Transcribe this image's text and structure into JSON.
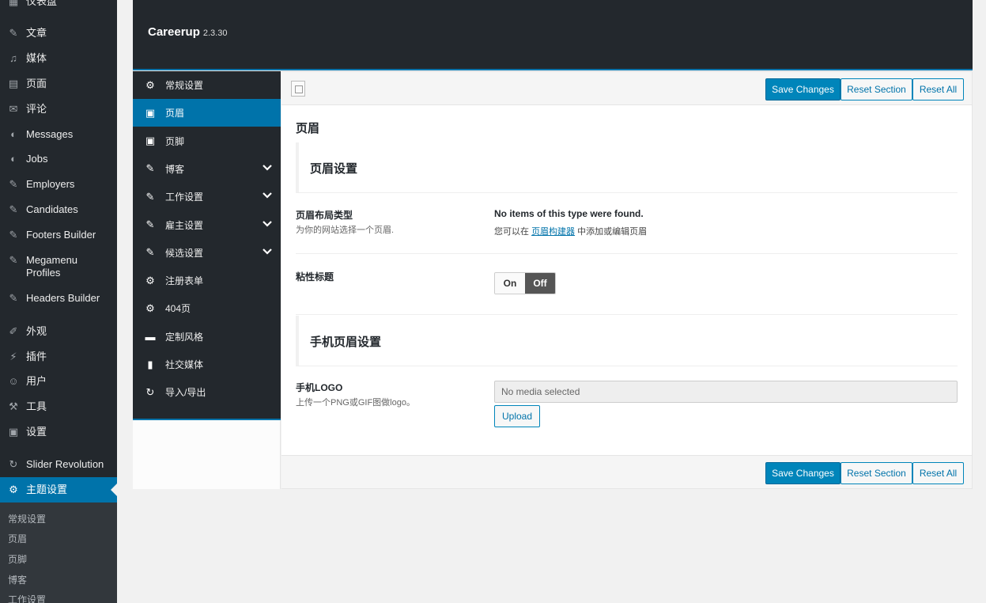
{
  "wp_menu": {
    "items": [
      {
        "label": "仪表盘",
        "icon": "dashboard-icon",
        "glyph": "▦"
      },
      {
        "label": "文章",
        "icon": "pin-icon",
        "glyph": "✎"
      },
      {
        "label": "媒体",
        "icon": "media-icon",
        "glyph": "♫"
      },
      {
        "label": "页面",
        "icon": "page-icon",
        "glyph": "▤"
      },
      {
        "label": "评论",
        "icon": "comment-icon",
        "glyph": "✉"
      },
      {
        "label": "Messages",
        "icon": "megaphone-icon",
        "glyph": "◐"
      },
      {
        "label": "Jobs",
        "icon": "megaphone-icon",
        "glyph": "◐"
      },
      {
        "label": "Employers",
        "icon": "pin-icon",
        "glyph": "✎"
      },
      {
        "label": "Candidates",
        "icon": "pin-icon",
        "glyph": "✎"
      },
      {
        "label": "Footers Builder",
        "icon": "pin-icon",
        "glyph": "✎"
      },
      {
        "label": "Megamenu Profiles",
        "icon": "pin-icon",
        "glyph": "✎"
      },
      {
        "label": "Headers Builder",
        "icon": "pin-icon",
        "glyph": "✎"
      },
      {
        "label": "外观",
        "icon": "appearance-icon",
        "glyph": "✐"
      },
      {
        "label": "插件",
        "icon": "plugin-icon",
        "glyph": "⚡"
      },
      {
        "label": "用户",
        "icon": "user-icon",
        "glyph": "☺"
      },
      {
        "label": "工具",
        "icon": "wrench-icon",
        "glyph": "⚒"
      },
      {
        "label": "设置",
        "icon": "settings-icon",
        "glyph": "▣"
      },
      {
        "label": "Slider Revolution",
        "icon": "refresh-icon",
        "glyph": "↻"
      },
      {
        "label": "主题设置",
        "icon": "gear-icon",
        "glyph": "⚙"
      }
    ],
    "submenu": [
      "常规设置",
      "页眉",
      "页脚",
      "博客",
      "工作设置"
    ]
  },
  "panel": {
    "title": "Careerup",
    "version": "2.3.30"
  },
  "options_nav": [
    {
      "label": "常规设置",
      "icon": "gears-icon",
      "glyph": "⚙"
    },
    {
      "label": "页眉",
      "icon": "window-icon",
      "glyph": "▣"
    },
    {
      "label": "页脚",
      "icon": "window-icon",
      "glyph": "▣"
    },
    {
      "label": "博客",
      "icon": "pencil-icon",
      "glyph": "✎"
    },
    {
      "label": "工作设置",
      "icon": "pencil-icon",
      "glyph": "✎"
    },
    {
      "label": "雇主设置",
      "icon": "pencil-icon",
      "glyph": "✎"
    },
    {
      "label": "候选设置",
      "icon": "pencil-icon",
      "glyph": "✎"
    },
    {
      "label": "注册表单",
      "icon": "gear-icon",
      "glyph": "⚙"
    },
    {
      "label": "404页",
      "icon": "gear-icon",
      "glyph": "⚙"
    },
    {
      "label": "定制风格",
      "icon": "css-icon",
      "glyph": "▬"
    },
    {
      "label": "社交媒体",
      "icon": "file-icon",
      "glyph": "▮"
    },
    {
      "label": "导入/导出",
      "icon": "refresh-icon",
      "glyph": "↻"
    }
  ],
  "toolbar": {
    "save": "Save Changes",
    "reset_section": "Reset Section",
    "reset_all": "Reset All"
  },
  "section": {
    "title": "页眉",
    "header_settings": "页眉设置",
    "layout": {
      "label": "页眉布局类型",
      "desc": "为你的网站选择一个页眉.",
      "value": "No items of this type were found.",
      "hint_prefix": "您可以在",
      "hint_link": "页眉构建器",
      "hint_suffix": "中添加或编辑页眉"
    },
    "sticky": {
      "label": "粘性标题",
      "on": "On",
      "off": "Off"
    },
    "mobile_settings": "手机页眉设置",
    "mobile_logo": {
      "label": "手机LOGO",
      "desc": "上传一个PNG或GIF图做logo。",
      "placeholder": "No media selected",
      "upload": "Upload"
    }
  }
}
